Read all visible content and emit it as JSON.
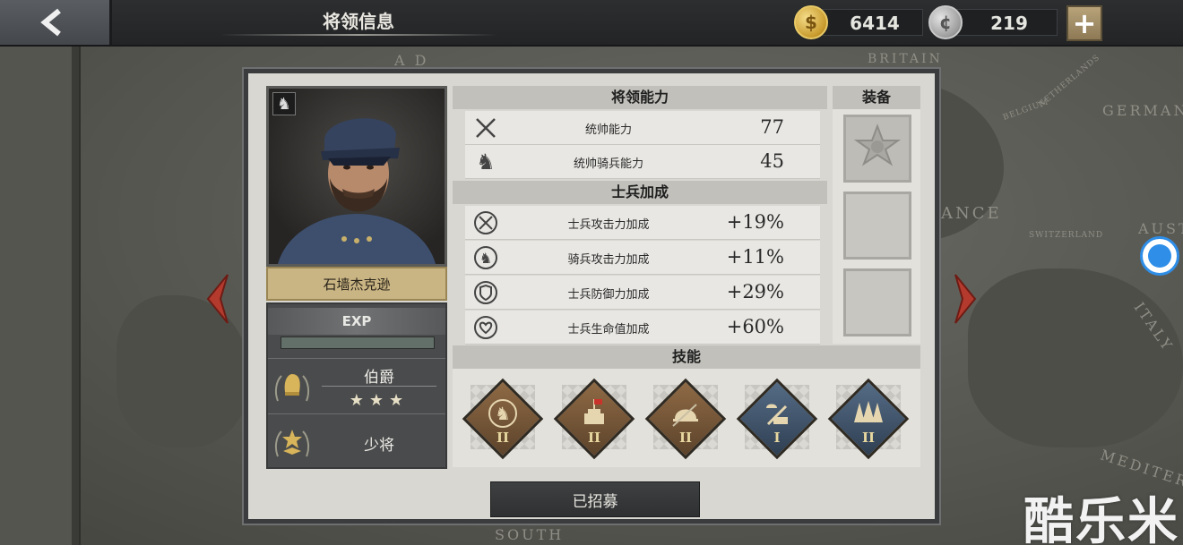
{
  "header": {
    "title": "将领信息",
    "gold": "6414",
    "silver": "219",
    "plus_label": "+"
  },
  "map_labels": [
    "A D",
    "BRITAIN",
    "NETHERLANDS",
    "BELGIUM",
    "GERMANY",
    "ANCE",
    "SWITZERLAND",
    "AUST",
    "ITALY",
    "MEDITER",
    "SOUTH"
  ],
  "general": {
    "name": "石墙杰克逊",
    "exp_label": "EXP",
    "exp_progress": 0,
    "title_rank": "伯爵",
    "stars": "★★★",
    "military_rank": "少将"
  },
  "abilities": {
    "header": "将领能力",
    "rows": [
      {
        "label": "统帅能力",
        "value": "77"
      },
      {
        "label": "统帅骑兵能力",
        "value": "45"
      }
    ]
  },
  "bonuses": {
    "header": "士兵加成",
    "rows": [
      {
        "label": "士兵攻击力加成",
        "value": "+19%"
      },
      {
        "label": "骑兵攻击力加成",
        "value": "+11%"
      },
      {
        "label": "士兵防御力加成",
        "value": "+29%"
      },
      {
        "label": "士兵生命值加成",
        "value": "+60%"
      }
    ]
  },
  "equipment": {
    "header": "装备",
    "slots": [
      "medal",
      "empty",
      "empty"
    ]
  },
  "skills": {
    "header": "技能",
    "items": [
      {
        "icon": "cavalry-icon",
        "level": "II",
        "color": "brown"
      },
      {
        "icon": "fortification-icon",
        "level": "II",
        "color": "brown"
      },
      {
        "icon": "helmet-icon",
        "level": "II",
        "color": "brown"
      },
      {
        "icon": "engineer-icon",
        "level": "I",
        "color": "blue"
      },
      {
        "icon": "forest-icon",
        "level": "II",
        "color": "blue"
      }
    ]
  },
  "recruit_button": "已招募",
  "watermark": "酷乐米"
}
